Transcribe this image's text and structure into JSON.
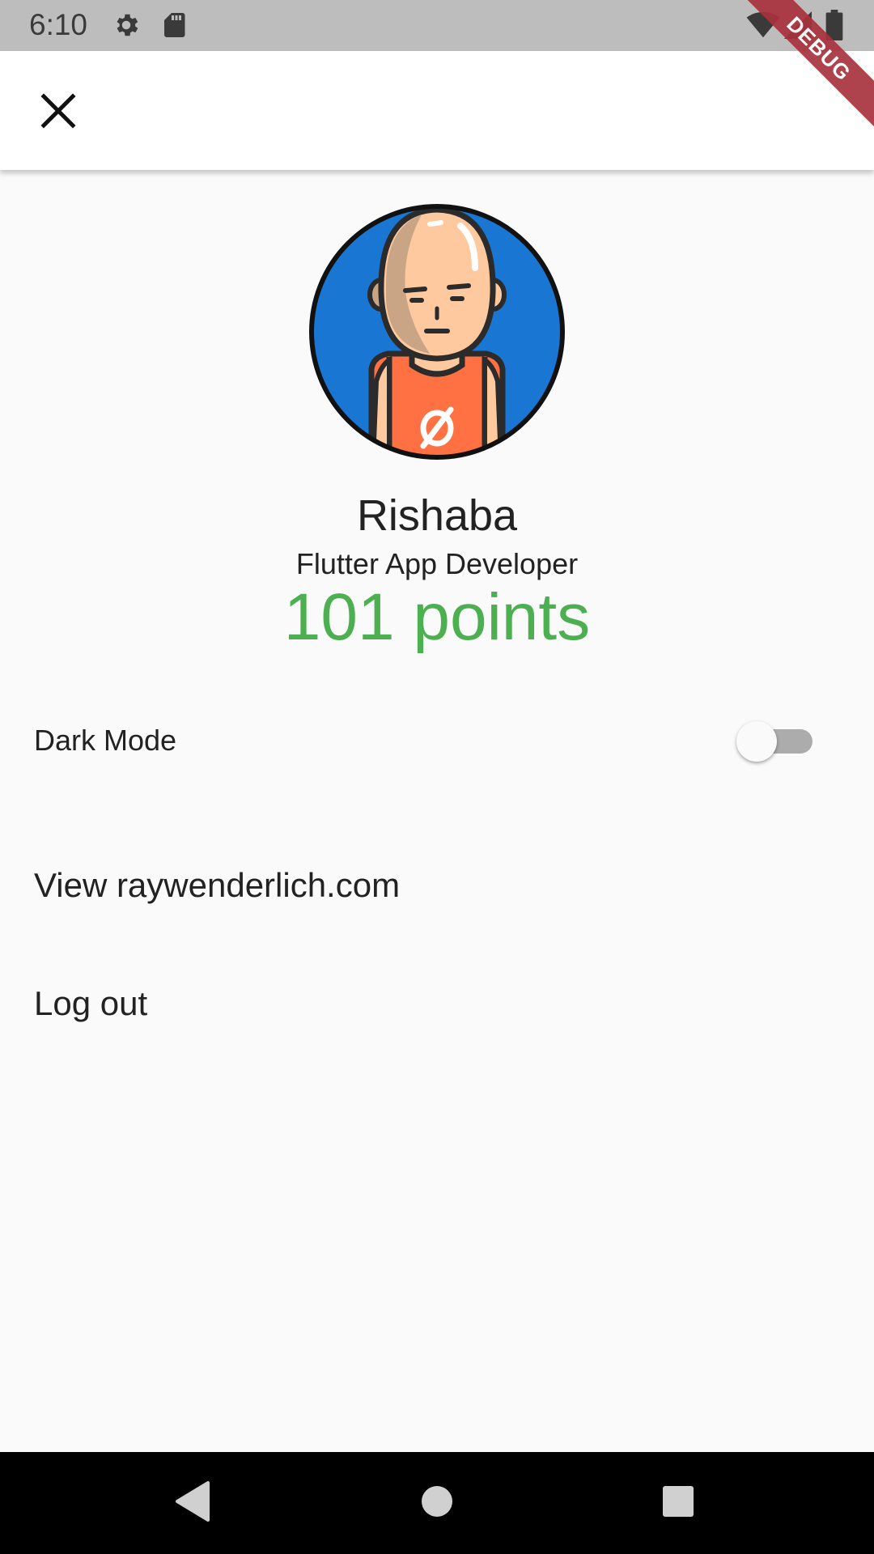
{
  "status_bar": {
    "time": "6:10",
    "icons": [
      "settings-icon",
      "sd-card-icon",
      "wifi-icon",
      "signal-icon",
      "battery-icon"
    ],
    "background": "#bdbdbd"
  },
  "debug_banner": {
    "label": "DEBUG",
    "color": "#a8323e"
  },
  "app_bar": {
    "close_icon": "close-icon"
  },
  "profile": {
    "avatar_icon": "avatar-illustration",
    "name": "Rishaba",
    "role": "Flutter App Developer",
    "points": "101 points",
    "points_color": "#4caf50",
    "avatar_bg": "#1976d2"
  },
  "settings": {
    "dark_mode_label": "Dark Mode",
    "dark_mode_enabled": false,
    "view_link": "View raywenderlich.com",
    "logout": "Log out"
  },
  "nav_bar": {
    "icons": [
      "back-icon",
      "home-icon",
      "recents-icon"
    ]
  }
}
